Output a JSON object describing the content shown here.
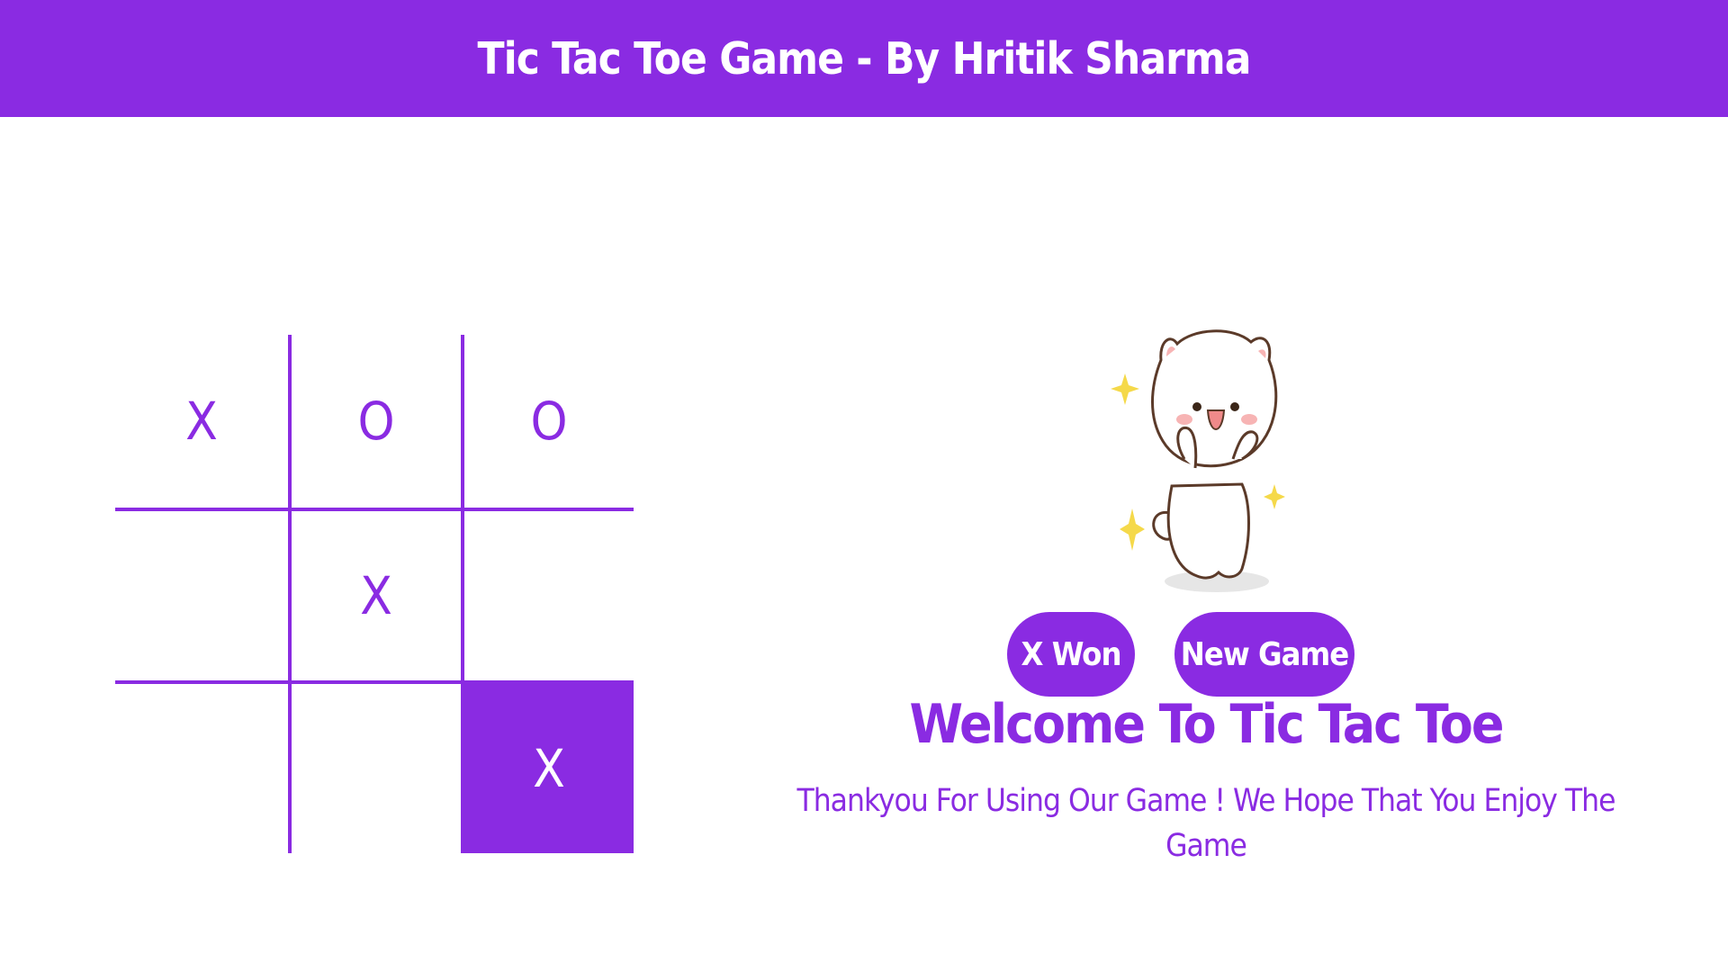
{
  "header": {
    "title": "Tic Tac Toe Game - By Hritik Sharma"
  },
  "board": {
    "cells": [
      "X",
      "O",
      "O",
      "",
      "X",
      "",
      "",
      "",
      "X"
    ],
    "highlighted_cell": 8
  },
  "status_button": {
    "label": "X Won"
  },
  "new_game_button": {
    "label": "New Game"
  },
  "welcome": {
    "heading": "Welcome To Tic Tac Toe",
    "message": "Thankyou For Using Our Game ! We Hope That You Enjoy The Game"
  },
  "colors": {
    "accent": "#8a2be2",
    "background": "#ffffff",
    "text_on_accent": "#ffffff"
  },
  "mascot": {
    "icon": "cat-mascot-icon"
  }
}
